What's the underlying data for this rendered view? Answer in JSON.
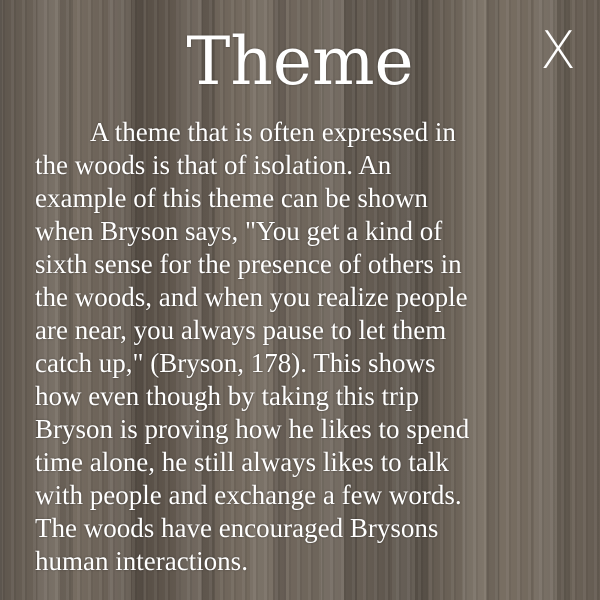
{
  "title": "Theme",
  "close_label": "X",
  "body_lines": [
    "A theme that is often expressed in",
    "the woods is that of isolation. An",
    "example of this theme can be shown",
    "when Bryson says, \"You get a kind of",
    "sixth sense for the presence of others in",
    "the woods, and when you realize people",
    "are near, you always pause to let them",
    "catch up,\" (Bryson, 178). This shows",
    "how even though by taking this trip",
    "Bryson is proving how he likes to spend",
    "time alone, he still always likes to talk",
    "with people and exchange a few words.",
    "The woods have encouraged Brysons",
    "human interactions."
  ]
}
